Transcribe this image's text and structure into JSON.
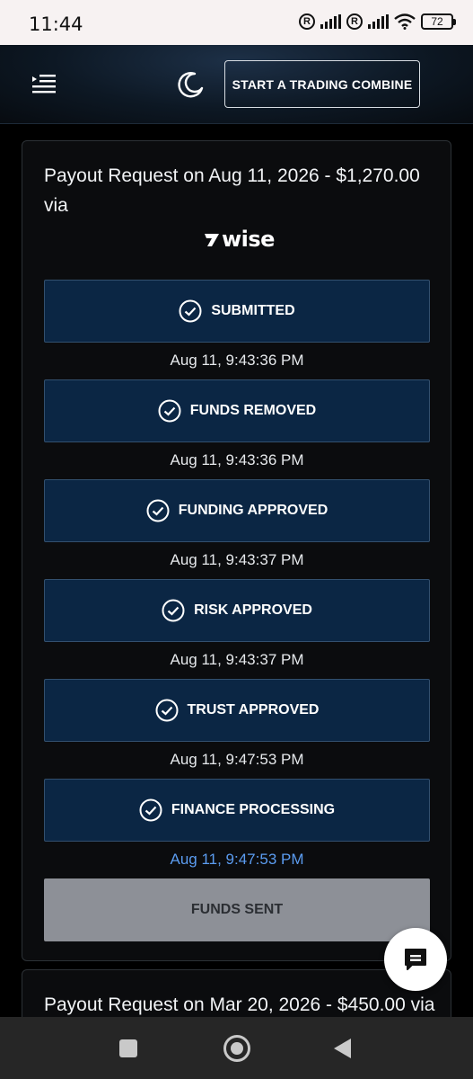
{
  "status_bar": {
    "time": "11:44",
    "battery": "72",
    "icons": [
      "registered-icon",
      "signal-icon",
      "registered-icon",
      "signal-icon",
      "wifi-icon",
      "battery-icon"
    ]
  },
  "header": {
    "cta_label": "START A TRADING COMBINE",
    "icons": [
      "menu-icon",
      "moon-icon"
    ]
  },
  "payouts": [
    {
      "title": "Payout Request on Aug 11, 2026 - $1,270.00 via",
      "method": "wise",
      "steps": [
        {
          "label": "SUBMITTED",
          "time": "Aug 11, 9:43:36 PM",
          "status": "done"
        },
        {
          "label": "FUNDS REMOVED",
          "time": "Aug 11, 9:43:36 PM",
          "status": "done"
        },
        {
          "label": "FUNDING APPROVED",
          "time": "Aug 11, 9:43:37 PM",
          "status": "done"
        },
        {
          "label": "RISK APPROVED",
          "time": "Aug 11, 9:43:37 PM",
          "status": "done"
        },
        {
          "label": "TRUST APPROVED",
          "time": "Aug 11, 9:47:53 PM",
          "status": "done"
        },
        {
          "label": "FINANCE PROCESSING",
          "time": "Aug 11, 9:47:53 PM",
          "status": "current"
        },
        {
          "label": "FUNDS SENT",
          "time": "",
          "status": "pending"
        }
      ]
    },
    {
      "title": "Payout Request on Mar 20, 2026 - $450.00 via"
    }
  ],
  "colors": {
    "step_bg": "#0b2644",
    "step_border": "#33506e",
    "pending_bg": "#8d9097",
    "active_time": "#5b9cf0"
  }
}
